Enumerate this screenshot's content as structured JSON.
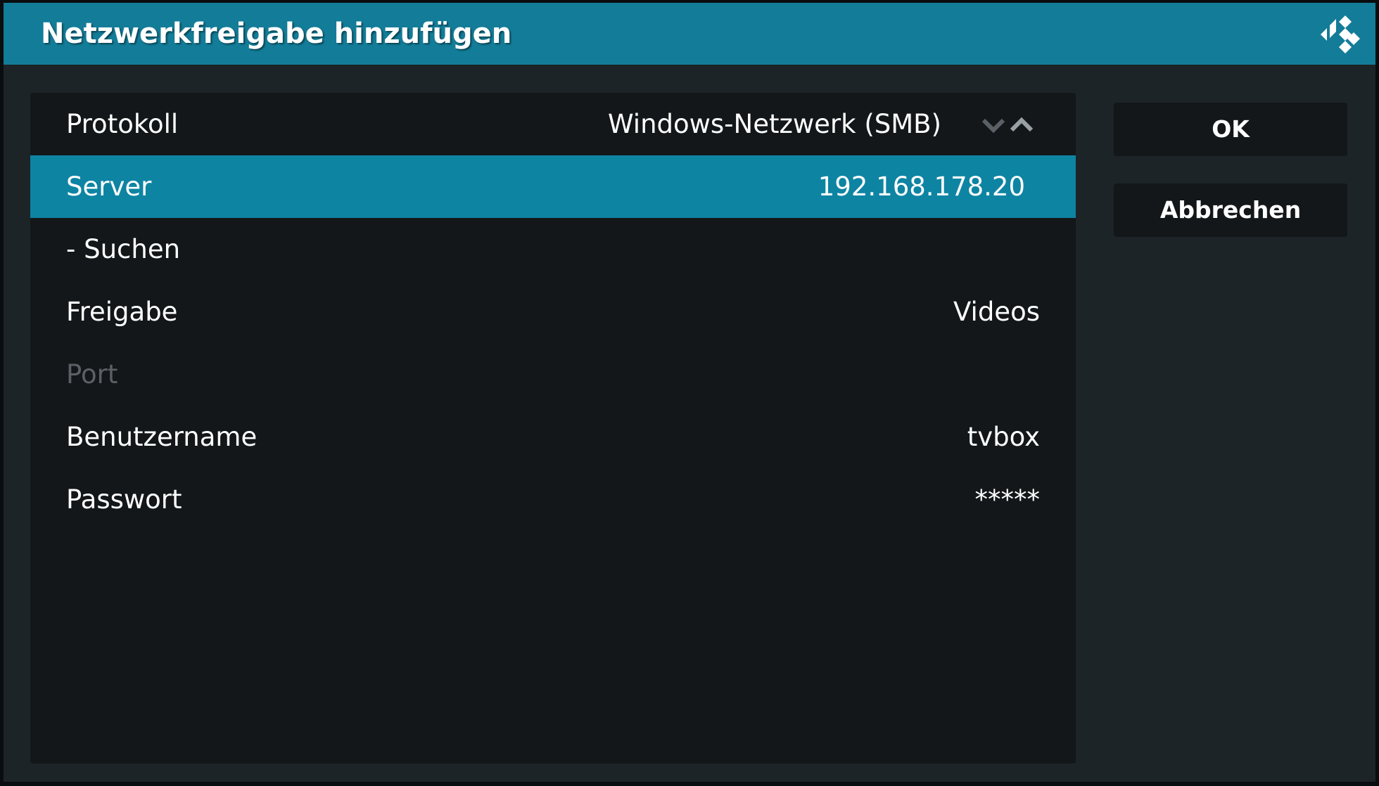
{
  "dialog": {
    "title": "Netzwerkfreigabe hinzufügen",
    "logo_icon": "kodi-logo-icon",
    "accent_color": "#137c98",
    "focus_color": "#0e84a3"
  },
  "settings": [
    {
      "label": "Protokoll",
      "value": "Windows-Netzwerk (SMB)"
    },
    {
      "label": "Server",
      "value": "192.168.178.20"
    },
    {
      "label": "- Suchen",
      "value": ""
    },
    {
      "label": "Freigabe",
      "value": "Videos"
    },
    {
      "label": "Port",
      "value": ""
    },
    {
      "label": "Benutzername",
      "value": "tvbox"
    },
    {
      "label": "Passwort",
      "value": "*****"
    }
  ],
  "buttons": {
    "ok_label": "OK",
    "cancel_label": "Abbrechen"
  },
  "icons": {
    "spinner_down": "chevron-down-icon",
    "spinner_up": "chevron-up-icon"
  }
}
